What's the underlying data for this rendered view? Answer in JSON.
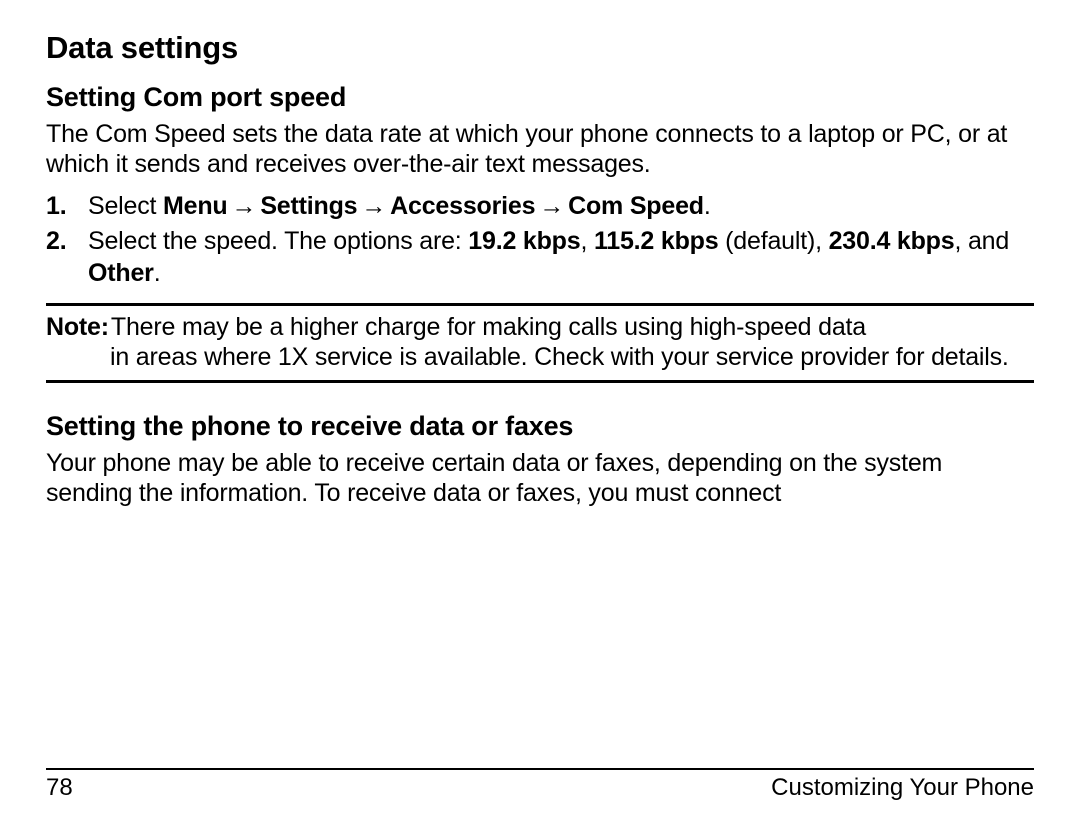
{
  "heading1": "Data settings",
  "section1": {
    "title": "Setting Com port speed",
    "intro": "The Com Speed sets the data rate at which your phone connects to a laptop or PC, or at which it sends and receives over-the-air text messages.",
    "step1": {
      "num": "1.",
      "lead": "Select ",
      "menu": "Menu",
      "settings": "Settings",
      "accessories": "Accessories",
      "comspeed": "Com Speed",
      "period": "."
    },
    "step2": {
      "num": "2.",
      "pre": "Select the speed. The options are: ",
      "opt1": "19.2 kbps",
      "sep1": ", ",
      "opt2": "115.2 kbps",
      "def": " (default), ",
      "opt3": "230.4 kbps",
      "sep2": ", and ",
      "opt4": "Other",
      "period": "."
    },
    "note": {
      "label": "Note:",
      "line1": " There may be a higher charge for making calls using high-speed data",
      "line2": "in areas where 1X service is available. Check with your service provider for details."
    }
  },
  "section2": {
    "title": "Setting the phone to receive data or faxes",
    "para": "Your phone may be able to receive certain data or faxes, depending on the system sending the information. To receive data or faxes, you must connect"
  },
  "footer": {
    "page": "78",
    "chapter": "Customizing Your Phone"
  },
  "arrow": "→"
}
